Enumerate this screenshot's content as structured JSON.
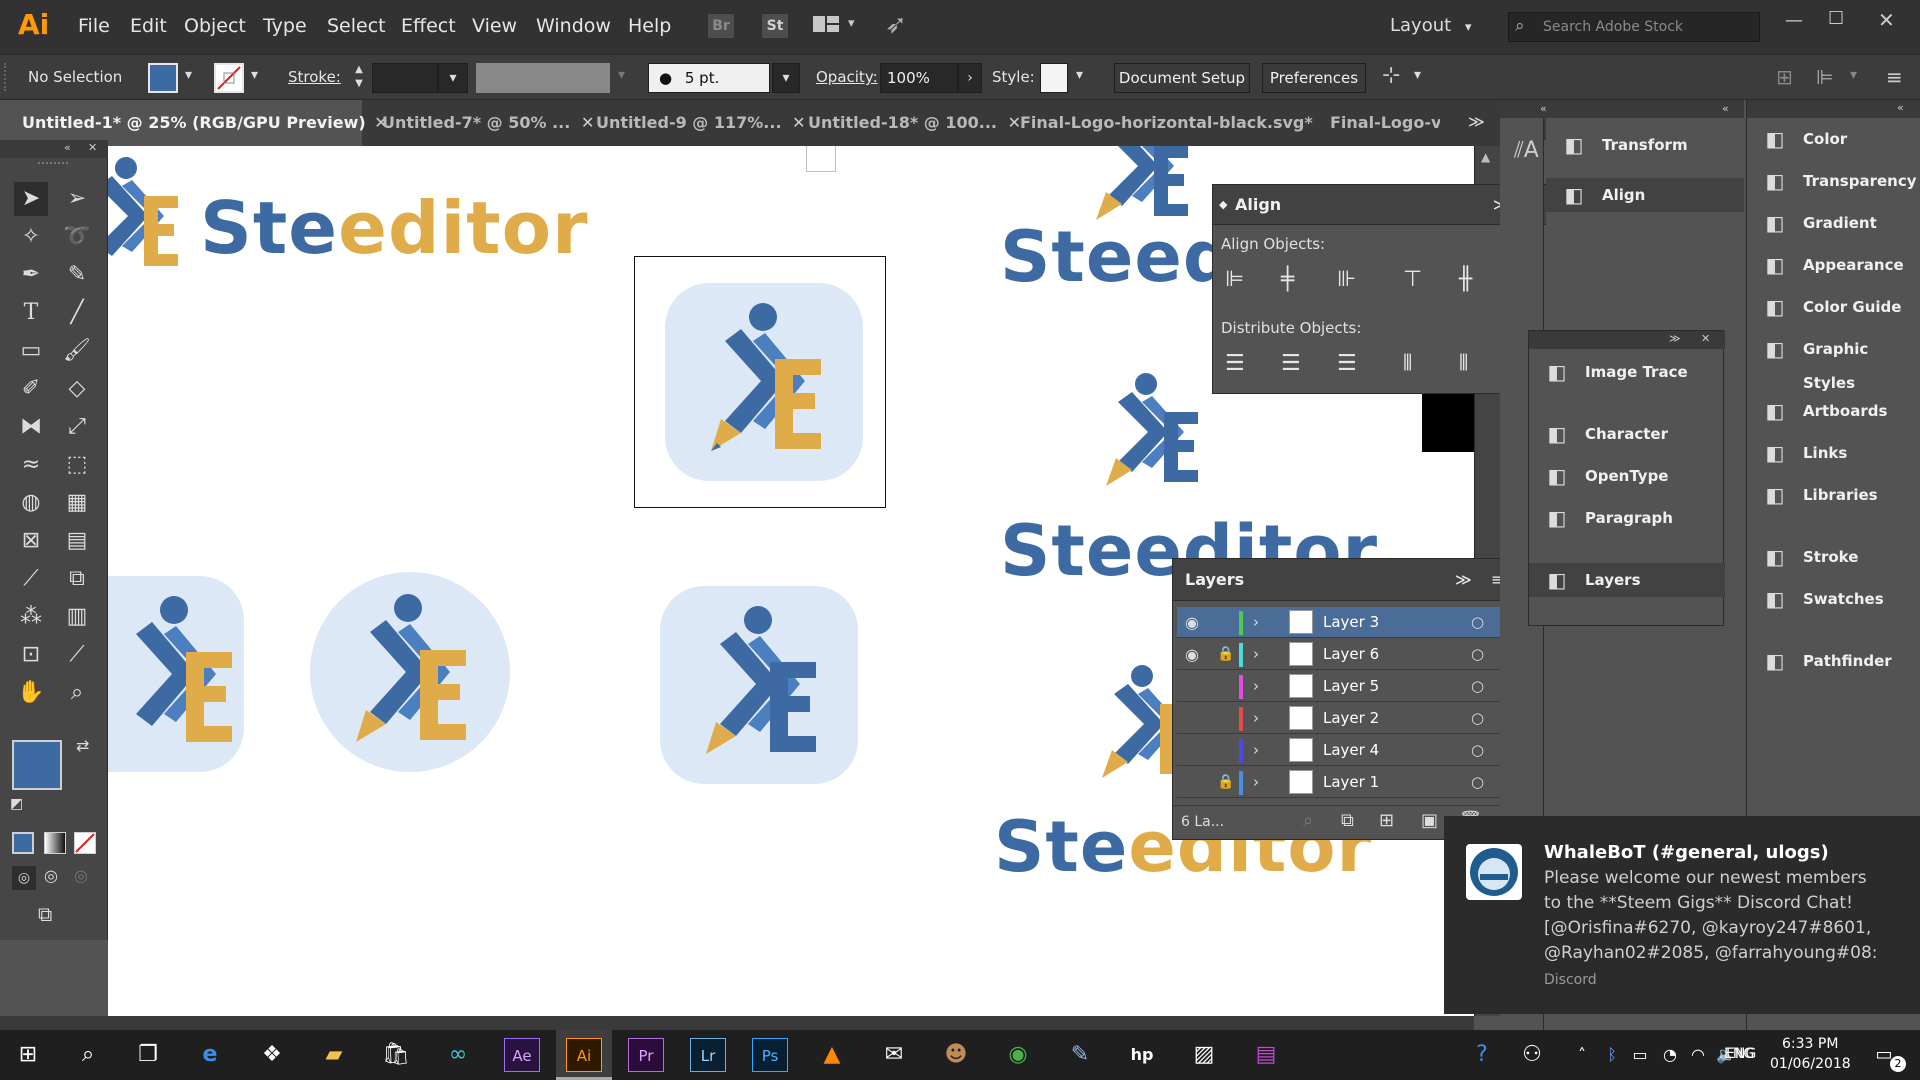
{
  "app": {
    "logo_text": "Ai"
  },
  "menu": [
    "File",
    "Edit",
    "Object",
    "Type",
    "Select",
    "Effect",
    "View",
    "Window",
    "Help"
  ],
  "menubar_right": {
    "bridge": "Br",
    "stock": "St",
    "workspace": "Layout",
    "search_placeholder": "Search Adobe Stock"
  },
  "control": {
    "selection": "No Selection",
    "stroke_label": "Stroke:",
    "brush": "5 pt. Round",
    "opacity_label": "Opacity:",
    "opacity_value": "100%",
    "style_label": "Style:",
    "document_setup": "Document Setup",
    "preferences": "Preferences",
    "fill_color": "#3d6aa3"
  },
  "tabs": [
    {
      "label": "Untitled-1* @ 25% (RGB/GPU Preview)"
    },
    {
      "label": "Untitled-7* @ 50% ..."
    },
    {
      "label": "Untitled-9 @ 117%..."
    },
    {
      "label": "Untitled-18* @ 100..."
    },
    {
      "label": "Final-Logo-horizontal-black.svg*"
    },
    {
      "label": "Final-Logo-ve"
    }
  ],
  "artwork": {
    "wordmark_a": "Ste",
    "wordmark_b": "editor",
    "wordmark_partial_1": "Steedi",
    "wordmark_partial_2": "Steeditor",
    "wordmark_partial_3a": "Ste",
    "wordmark_partial_3b": "editor",
    "brand_blue": "#3d6aa3",
    "brand_gold": "#e0ac4a",
    "badge_bg": "#dce8f6"
  },
  "align_panel": {
    "title": "Align",
    "align_objects": "Align Objects:",
    "distribute_objects": "Distribute Objects:"
  },
  "layers_panel": {
    "title": "Layers",
    "footer": "6 La...",
    "layers": [
      {
        "name": "Layer 3",
        "color": "#4ecb4e",
        "visible": true,
        "locked": false,
        "selected": true
      },
      {
        "name": "Layer 6",
        "color": "#4ddcdc",
        "visible": true,
        "locked": true,
        "selected": false
      },
      {
        "name": "Layer 5",
        "color": "#e24ce2",
        "visible": false,
        "locked": false,
        "selected": false
      },
      {
        "name": "Layer 2",
        "color": "#e24c4c",
        "visible": false,
        "locked": false,
        "selected": false
      },
      {
        "name": "Layer 4",
        "color": "#4c4ce2",
        "visible": false,
        "locked": false,
        "selected": false
      },
      {
        "name": "Layer 1",
        "color": "#4c8ce2",
        "visible": false,
        "locked": true,
        "selected": false
      }
    ]
  },
  "dock_middle_top": [
    {
      "label": "Transform",
      "icon": "transform-icon"
    },
    {
      "label": "Align",
      "icon": "align-icon"
    }
  ],
  "dock_middle_bottom": [
    {
      "label": "Image Trace",
      "icon": "image-trace-icon"
    },
    {
      "label": "Character",
      "icon": "character-icon"
    },
    {
      "label": "OpenType",
      "icon": "opentype-icon"
    },
    {
      "label": "Paragraph",
      "icon": "paragraph-icon"
    },
    {
      "label": "Layers",
      "icon": "layers-icon"
    }
  ],
  "dock_right": [
    {
      "label": "Color",
      "icon": "color-icon"
    },
    {
      "label": "Transparency",
      "icon": "transparency-icon"
    },
    {
      "label": "Gradient",
      "icon": "gradient-icon"
    },
    {
      "label": "Appearance",
      "icon": "appearance-icon"
    },
    {
      "label": "Color Guide",
      "icon": "color-guide-icon"
    },
    {
      "label": "Graphic Styles",
      "icon": "graphic-styles-icon"
    },
    {
      "label": "Artboards",
      "icon": "artboards-icon"
    },
    {
      "label": "Links",
      "icon": "links-icon"
    },
    {
      "label": "Libraries",
      "icon": "libraries-icon"
    },
    {
      "label": "Stroke",
      "icon": "stroke-icon"
    },
    {
      "label": "Swatches",
      "icon": "swatches-icon"
    },
    {
      "label": "Pathfinder",
      "icon": "pathfinder-icon"
    }
  ],
  "notification": {
    "title": "WhaleBoT (#general, ulogs)",
    "lines": [
      "Please welcome our newest members",
      "to the **Steem Gigs** Discord Chat!",
      "[@Orisfina#6270, @kayroy247#8601,",
      "@Rayhan02#2085, @farrahyoung#08:"
    ],
    "source": "Discord"
  },
  "taskbar": {
    "apps": [
      "Ae",
      "Ai",
      "Pr",
      "Lr",
      "Ps"
    ],
    "lang": "ENG",
    "time": "6:33 PM",
    "date": "01/06/2018",
    "notif_count": "2"
  }
}
